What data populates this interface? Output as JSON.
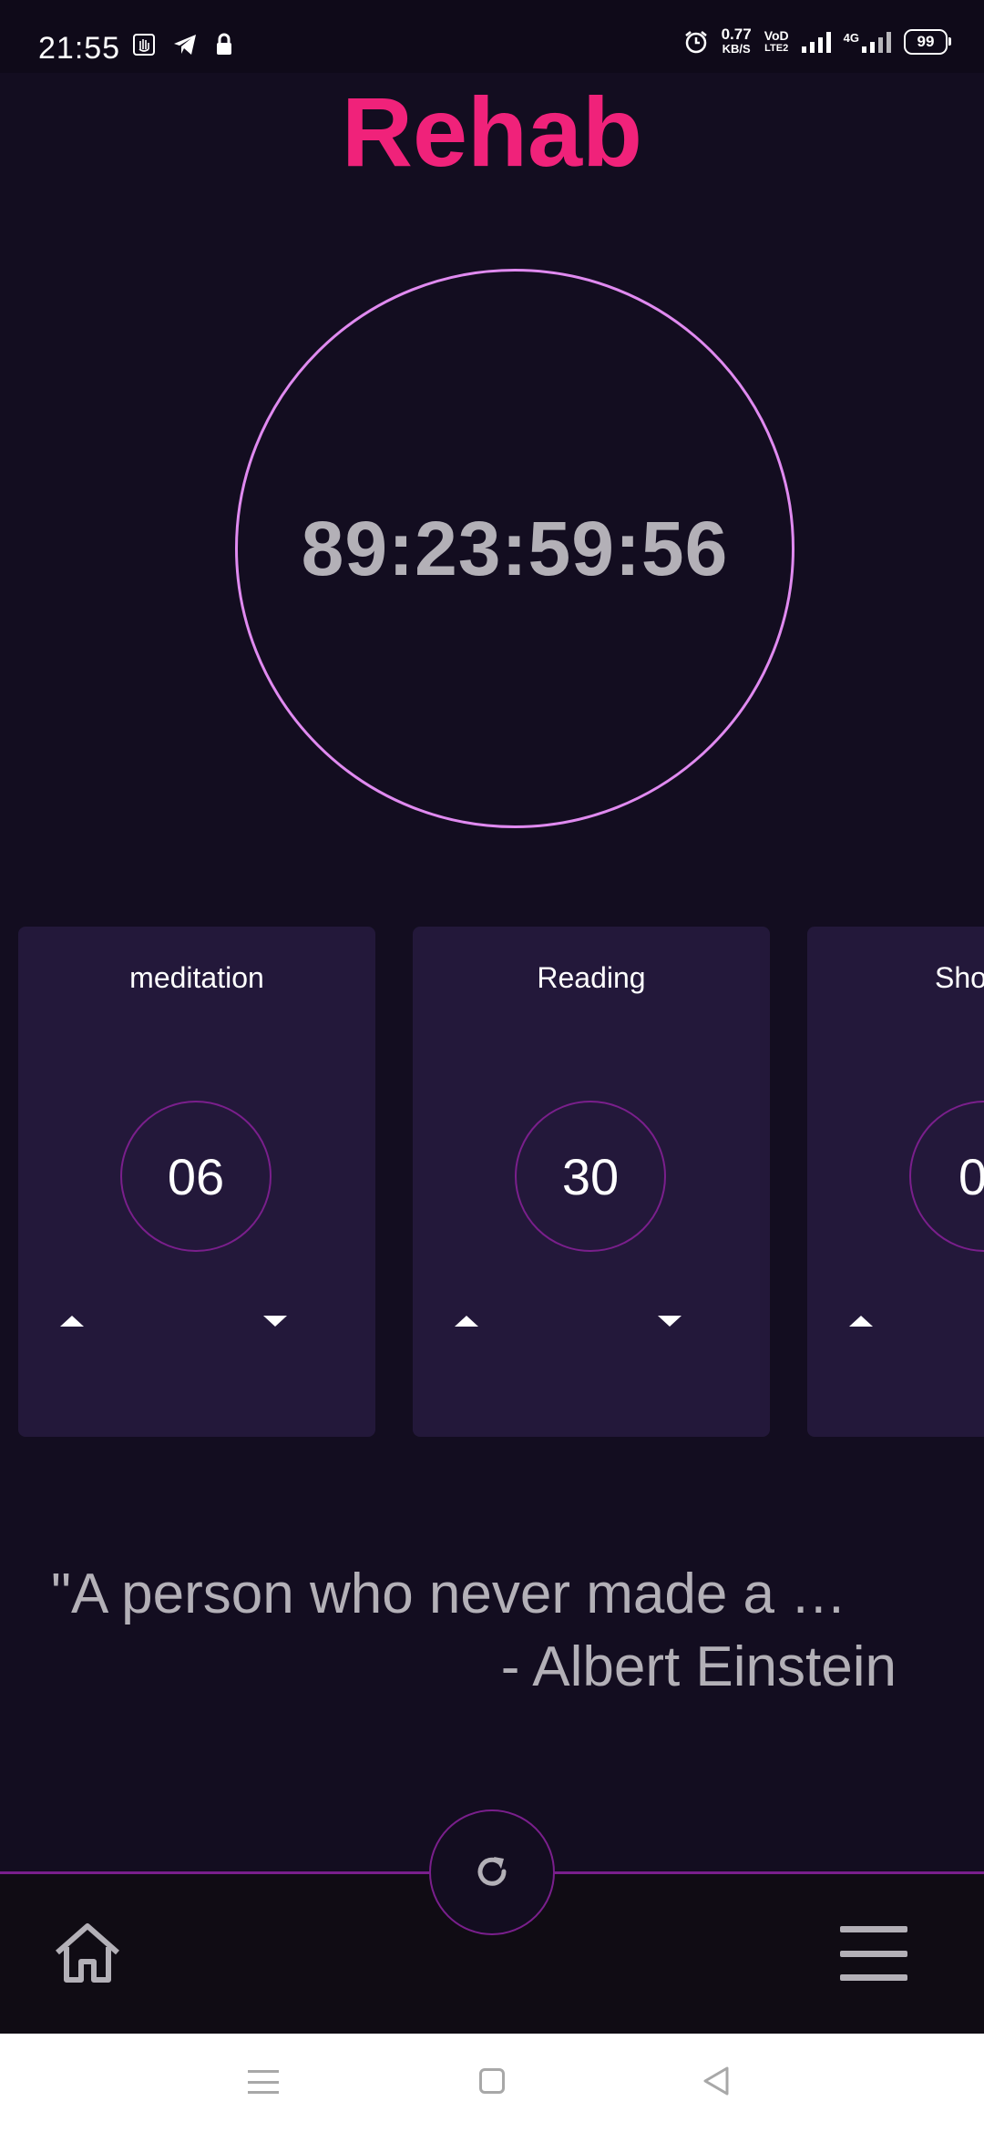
{
  "status_bar": {
    "time": "21:55",
    "net_speed_value": "0.77",
    "net_speed_unit": "KB/S",
    "volte_line1": "VoD",
    "volte_line2": "LTE2",
    "network_4g": "4G",
    "battery": "99"
  },
  "app": {
    "title": "Rehab",
    "timer": "89:23:59:56"
  },
  "cards": [
    {
      "label": "meditation",
      "value": "06"
    },
    {
      "label": "Reading",
      "value": "30"
    },
    {
      "label": "Sho",
      "value": "0"
    }
  ],
  "quote": {
    "text": "\"A person who never made a …",
    "author": "- Albert Einstein"
  },
  "colors": {
    "background": "#130d20",
    "title": "#f0227a",
    "ring": "#e08af0",
    "card": "#23183a",
    "accent_line": "#7a1f8c",
    "muted_text": "#b3b0b7"
  },
  "icons": {
    "refresh": "refresh-icon",
    "home": "home-icon",
    "menu": "hamburger-menu-icon"
  }
}
